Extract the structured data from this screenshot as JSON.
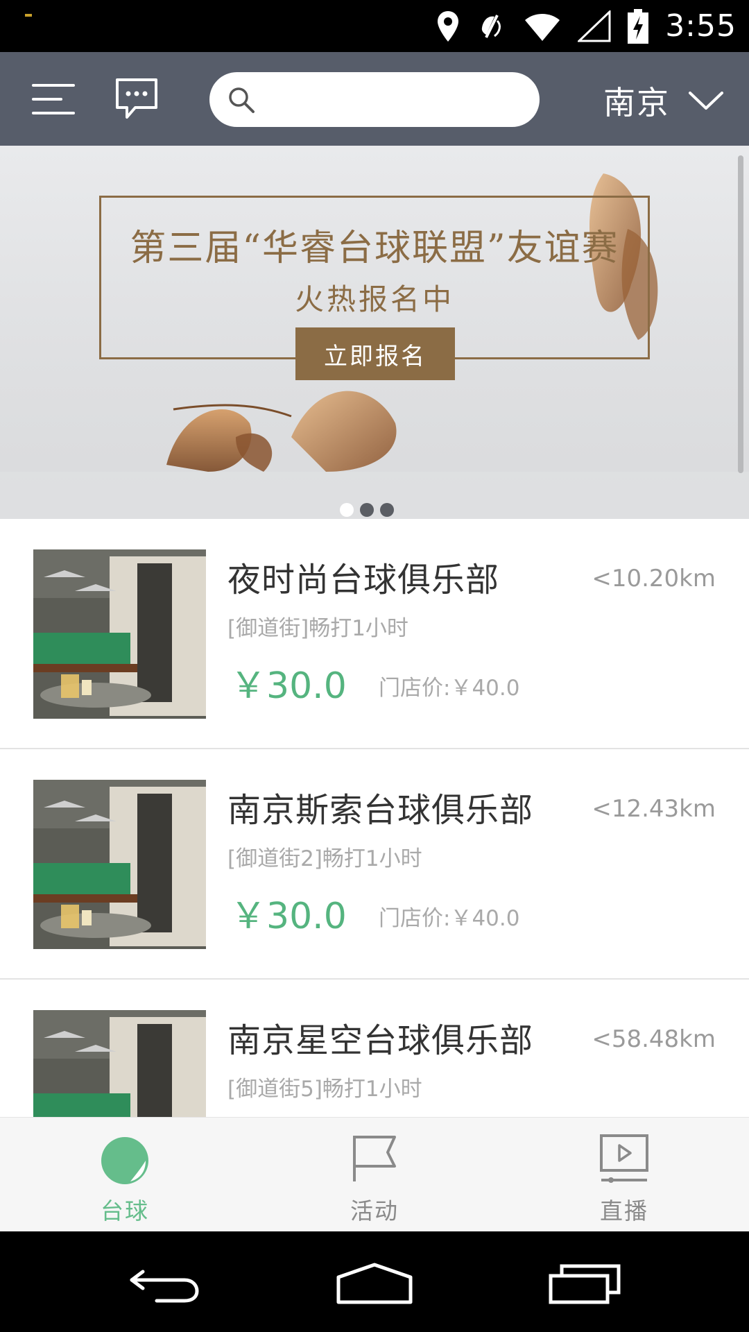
{
  "status_bar": {
    "time": "3:55"
  },
  "header": {
    "search_placeholder": "",
    "city": "南京"
  },
  "banner": {
    "title": "第三届“华睿台球联盟”友谊赛",
    "subtitle": "火热报名中",
    "cta_label": "立即报名",
    "page_count": 3,
    "active_page": 1
  },
  "clubs": [
    {
      "name": "夜时尚台球俱乐部",
      "distance": "<10.20km",
      "desc": "[御道街]畅打1小时",
      "price": "￥30.0",
      "store_price": "门店价:￥40.0"
    },
    {
      "name": "南京斯索台球俱乐部",
      "distance": "<12.43km",
      "desc": "[御道街2]畅打1小时",
      "price": "￥30.0",
      "store_price": "门店价:￥40.0"
    },
    {
      "name": "南京星空台球俱乐部",
      "distance": "<58.48km",
      "desc": "[御道街5]畅打1小时",
      "price": "",
      "store_price": ""
    }
  ],
  "tabs": [
    {
      "label": "台球",
      "icon": "billiard-ball-icon",
      "active": true
    },
    {
      "label": "活动",
      "icon": "flag-icon",
      "active": false
    },
    {
      "label": "直播",
      "icon": "video-play-icon",
      "active": false
    }
  ],
  "colors": {
    "header_bg": "#575d6a",
    "price_green": "#55b47f",
    "tab_active": "#65bd8b",
    "banner_brown": "#8b6c45"
  }
}
